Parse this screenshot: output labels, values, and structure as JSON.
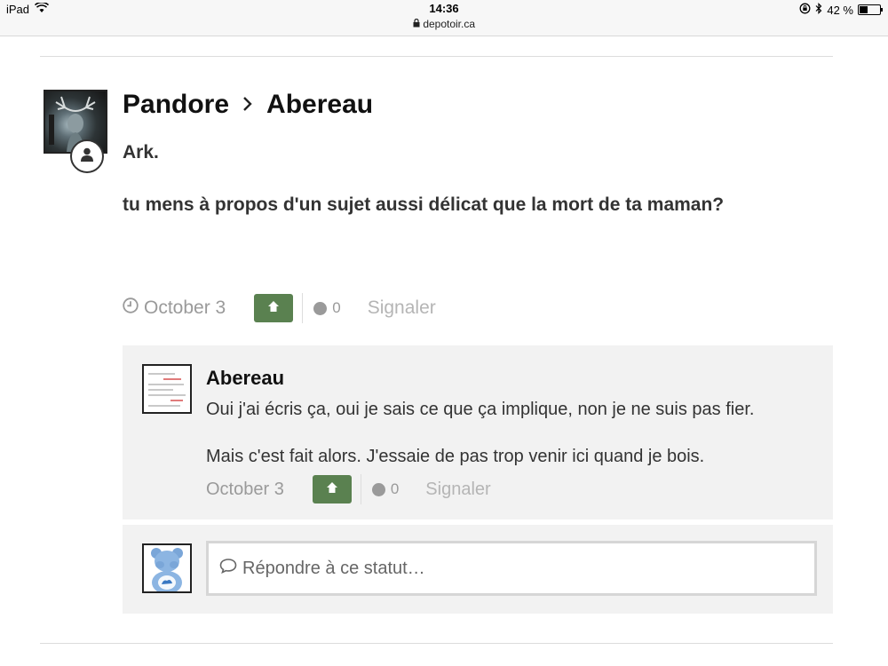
{
  "status_bar": {
    "device": "iPad",
    "time": "14:36",
    "url": "depotoir.ca",
    "battery": "42 %",
    "battery_level": 0.42
  },
  "post": {
    "author": "Pandore",
    "recipient": "Abereau",
    "line1": "Ark.",
    "line2": "tu mens à propos d'un sujet aussi délicat que la mort de ta maman?",
    "date": "October 3",
    "reaction_count": "0",
    "report_label": "Signaler"
  },
  "comment": {
    "author": "Abereau",
    "line1": "Oui j'ai écris ça, oui je sais ce que ça implique, non je ne suis pas fier.",
    "line2": "Mais c'est fait alors. J'essaie de pas trop venir ici quand je bois.",
    "date": "October 3",
    "reaction_count": "0",
    "report_label": "Signaler"
  },
  "reply": {
    "placeholder": "Répondre à ce statut…"
  },
  "colors": {
    "vote_button": "#5a8150",
    "meta_text": "#9a9a9a",
    "comment_bg": "#f2f2f2"
  },
  "icons": [
    "wifi-icon",
    "lock-icon",
    "bluetooth-icon",
    "rotation-lock-icon",
    "battery-icon",
    "chevron-right-icon",
    "user-icon",
    "clock-icon",
    "arrow-up-icon",
    "reaction-dot-icon",
    "speech-bubble-icon"
  ]
}
